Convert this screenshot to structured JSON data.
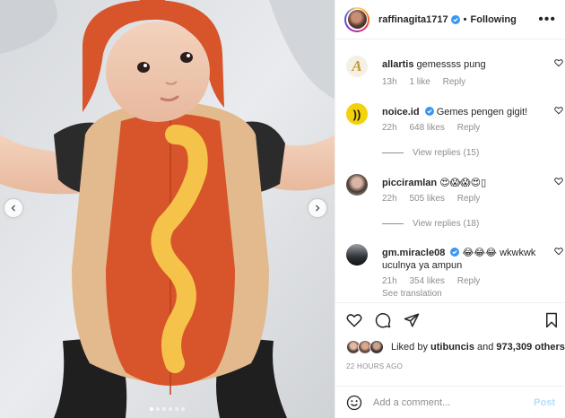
{
  "post": {
    "username": "raffinagita1717",
    "follow_state": "Following",
    "more_icon": "more-horizontal-icon",
    "verified_color": "#3897f0"
  },
  "carousel": {
    "total_slides": 6,
    "active_slide": 1
  },
  "comments": [
    {
      "user": "allartis",
      "text": "gemessss pung",
      "time": "13h",
      "likes": "1 like",
      "reply": "Reply",
      "verified": false
    },
    {
      "user": "noice.id",
      "text": "Gemes pengen gigit!",
      "time": "22h",
      "likes": "648 likes",
      "reply": "Reply",
      "verified": true,
      "view_replies": "View replies (15)"
    },
    {
      "user": "picciramlan",
      "text": "😍😱😱😍▯",
      "time": "22h",
      "likes": "505 likes",
      "reply": "Reply",
      "verified": false,
      "view_replies": "View replies (18)"
    },
    {
      "user": "gm.miracle08",
      "text": "😂😂😂 wkwkwk uculnya ya ampun",
      "time": "21h",
      "likes": "354 likes",
      "reply": "Reply",
      "verified": true,
      "see_translation": "See translation"
    }
  ],
  "likes": {
    "prefix": "Liked by",
    "first_user": "utibuncis",
    "conj": "and",
    "others": "973,309 others"
  },
  "timestamp": "22 HOURS AGO",
  "add_comment": {
    "placeholder": "Add a comment...",
    "post_label": "Post"
  },
  "colors": {
    "text": "#262626",
    "secondary": "#8e8e8e",
    "post_disabled": "#b2dffc"
  }
}
